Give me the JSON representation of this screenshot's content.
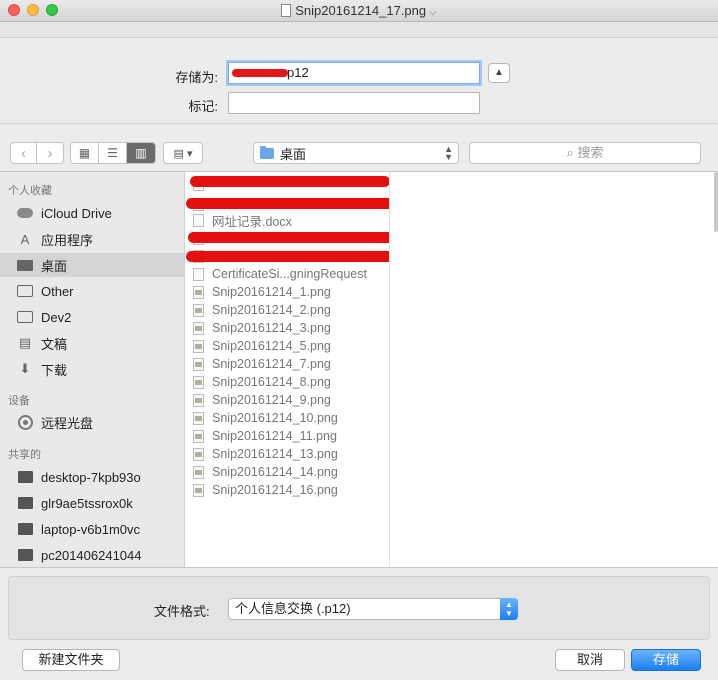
{
  "window": {
    "title": "Snip20161214_17.png"
  },
  "form": {
    "save_as_label": "存储为:",
    "save_as_value": "p12",
    "tags_label": "标记:",
    "tags_value": ""
  },
  "toolbar": {
    "location": "桌面",
    "search_placeholder": "搜索"
  },
  "sidebar": {
    "favorites_header": "个人收藏",
    "favorites": [
      {
        "label": "iCloud Drive",
        "icon": "cloud-icon"
      },
      {
        "label": "应用程序",
        "icon": "applications-icon"
      },
      {
        "label": "桌面",
        "icon": "desktop-icon",
        "selected": true
      },
      {
        "label": "Other",
        "icon": "folder-icon"
      },
      {
        "label": "Dev2",
        "icon": "folder-icon"
      },
      {
        "label": "文稿",
        "icon": "documents-icon"
      },
      {
        "label": "下载",
        "icon": "downloads-icon"
      }
    ],
    "devices_header": "设备",
    "devices": [
      {
        "label": "远程光盘",
        "icon": "disc-icon"
      }
    ],
    "shared_header": "共享的",
    "shared": [
      {
        "label": "desktop-7kpb93o",
        "icon": "monitor-icon"
      },
      {
        "label": "glr9ae5tssrox0k",
        "icon": "monitor-icon"
      },
      {
        "label": "laptop-v6b1m0vc",
        "icon": "monitor-icon"
      },
      {
        "label": "pc201406241044",
        "icon": "monitor-icon"
      }
    ]
  },
  "files": [
    {
      "name": "",
      "redacted": true
    },
    {
      "name": "",
      "redacted": true
    },
    {
      "name": "网址记录.docx"
    },
    {
      "name": "",
      "redacted": true
    },
    {
      "name": "",
      "redacted": true
    },
    {
      "name": "CertificateSi...gningRequest"
    },
    {
      "name": "Snip20161214_1.png"
    },
    {
      "name": "Snip20161214_2.png"
    },
    {
      "name": "Snip20161214_3.png"
    },
    {
      "name": "Snip20161214_5.png"
    },
    {
      "name": "Snip20161214_7.png"
    },
    {
      "name": "Snip20161214_8.png"
    },
    {
      "name": "Snip20161214_9.png"
    },
    {
      "name": "Snip20161214_10.png"
    },
    {
      "name": "Snip20161214_11.png"
    },
    {
      "name": "Snip20161214_13.png"
    },
    {
      "name": "Snip20161214_14.png"
    },
    {
      "name": "Snip20161214_16.png"
    }
  ],
  "format": {
    "label": "文件格式:",
    "selected": "个人信息交换 (.p12)"
  },
  "buttons": {
    "new_folder": "新建文件夹",
    "cancel": "取消",
    "save": "存储"
  }
}
